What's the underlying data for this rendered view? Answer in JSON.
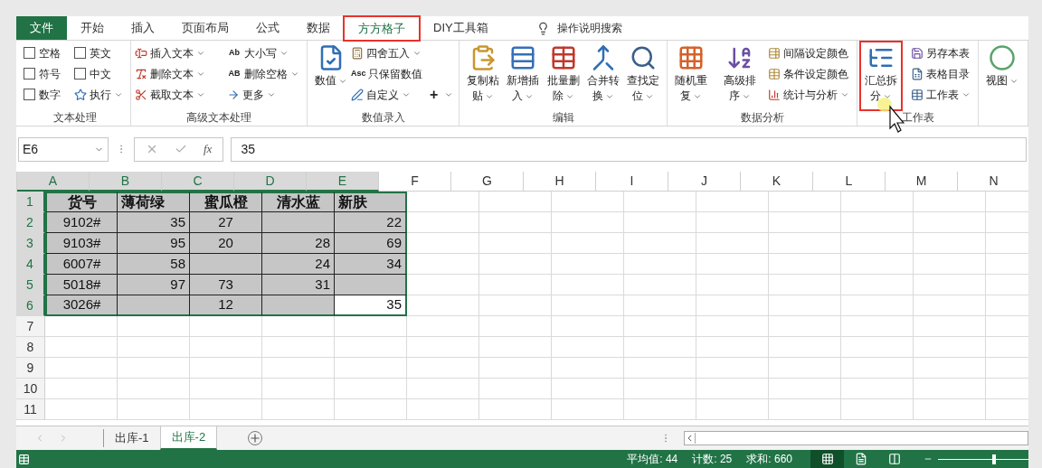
{
  "tabs": [
    {
      "label": "文件",
      "kind": "file",
      "selected": false,
      "highlighted": false
    },
    {
      "label": "开始",
      "kind": "tab",
      "selected": false,
      "highlighted": false
    },
    {
      "label": "插入",
      "kind": "tab",
      "selected": false,
      "highlighted": false
    },
    {
      "label": "页面布局",
      "kind": "tab",
      "selected": false,
      "highlighted": false
    },
    {
      "label": "公式",
      "kind": "tab",
      "selected": false,
      "highlighted": false
    },
    {
      "label": "数据",
      "kind": "tab",
      "selected": false,
      "highlighted": false
    },
    {
      "label": "方方格子",
      "kind": "tab",
      "selected": true,
      "highlighted": true
    },
    {
      "label": "DIY工具箱",
      "kind": "tab",
      "selected": false,
      "highlighted": false
    }
  ],
  "search": {
    "placeholder": "操作说明搜索"
  },
  "ribbon": [
    {
      "label": "文本处理",
      "columns": [
        {
          "kind": "stack",
          "items": [
            {
              "kind": "checkbox",
              "label": "空格",
              "checked": false
            },
            {
              "kind": "checkbox",
              "label": "符号",
              "checked": false
            },
            {
              "kind": "checkbox",
              "label": "数字",
              "checked": false
            }
          ]
        },
        {
          "kind": "stack",
          "items": [
            {
              "kind": "checkbox",
              "label": "英文",
              "checked": false
            },
            {
              "kind": "checkbox",
              "label": "中文",
              "checked": false
            },
            {
              "kind": "small",
              "label": "执行",
              "dropdown": true
            }
          ]
        }
      ]
    },
    {
      "label": "高级文本处理",
      "columns": [
        {
          "kind": "stack",
          "items": [
            {
              "kind": "small",
              "label": "插入文本",
              "dropdown": true
            },
            {
              "kind": "small",
              "label": "删除文本",
              "dropdown": true
            },
            {
              "kind": "small",
              "label": "截取文本",
              "dropdown": true
            }
          ]
        },
        {
          "kind": "stack",
          "items": [
            {
              "kind": "small",
              "label": "大小写",
              "icon_text": "Ab",
              "dropdown": true
            },
            {
              "kind": "small",
              "label": "删除空格",
              "icon_text": "AB",
              "dropdown": true
            },
            {
              "kind": "small",
              "label": "更多",
              "dropdown": true
            }
          ]
        }
      ]
    },
    {
      "label": "数值录入",
      "columns": [
        {
          "kind": "large",
          "label": "数值",
          "dropdown": true,
          "highlighted": false
        },
        {
          "kind": "stack",
          "items": [
            {
              "kind": "small",
              "label": "四舍五入",
              "dropdown": true
            },
            {
              "kind": "small",
              "label": "只保留数值",
              "icon_text": "Asc",
              "dropdown": false
            },
            {
              "kind": "small",
              "label": "自定义",
              "dropdown": true
            }
          ]
        },
        {
          "kind": "stack",
          "items": [
            {
              "kind": "spacer"
            },
            {
              "kind": "spacer"
            },
            {
              "kind": "plain",
              "label": "+",
              "dropdown": true
            }
          ]
        }
      ]
    },
    {
      "label": "编辑",
      "columns": [
        {
          "kind": "large",
          "label": "复制粘贴",
          "dropdown": true,
          "highlighted": false
        },
        {
          "kind": "large",
          "label": "新增插入",
          "dropdown": true,
          "highlighted": false
        },
        {
          "kind": "large",
          "label": "批量删除",
          "dropdown": true,
          "highlighted": false
        },
        {
          "kind": "large",
          "label": "合并转换",
          "dropdown": true,
          "highlighted": false
        },
        {
          "kind": "large",
          "label": "查找定位",
          "dropdown": true,
          "highlighted": false
        }
      ]
    },
    {
      "label": "数据分析",
      "columns": [
        {
          "kind": "large",
          "label": "随机重复",
          "dropdown": true,
          "highlighted": false
        },
        {
          "kind": "large",
          "label": "高级排序",
          "dropdown": true,
          "highlighted": false
        },
        {
          "kind": "stack",
          "items": [
            {
              "kind": "small",
              "label": "间隔设定颜色",
              "dropdown": false
            },
            {
              "kind": "small",
              "label": "条件设定颜色",
              "dropdown": false
            },
            {
              "kind": "small",
              "label": "统计与分析",
              "dropdown": true
            }
          ]
        }
      ]
    },
    {
      "label": "工作表",
      "columns": [
        {
          "kind": "large",
          "label": "汇总拆分",
          "dropdown": true,
          "highlighted": true
        },
        {
          "kind": "stack",
          "items": [
            {
              "kind": "small",
              "label": "另存本表",
              "dropdown": false
            },
            {
              "kind": "small",
              "label": "表格目录",
              "dropdown": false
            },
            {
              "kind": "small",
              "label": "工作表",
              "dropdown": true
            }
          ]
        }
      ]
    },
    {
      "columns": [
        {
          "kind": "large",
          "label": "视图",
          "dropdown": true,
          "highlighted": false
        }
      ]
    }
  ],
  "formula_bar": {
    "name_box": "E6",
    "function_label": "fx",
    "value": "35"
  },
  "columns": [
    {
      "label": "A",
      "selected": true
    },
    {
      "label": "B",
      "selected": true
    },
    {
      "label": "C",
      "selected": true
    },
    {
      "label": "D",
      "selected": true
    },
    {
      "label": "E",
      "selected": true
    },
    {
      "label": "F",
      "selected": false
    },
    {
      "label": "G",
      "selected": false
    },
    {
      "label": "H",
      "selected": false
    },
    {
      "label": "I",
      "selected": false
    },
    {
      "label": "J",
      "selected": false
    },
    {
      "label": "K",
      "selected": false
    },
    {
      "label": "L",
      "selected": false
    },
    {
      "label": "M",
      "selected": false
    },
    {
      "label": "N",
      "selected": false
    }
  ],
  "rows": [
    {
      "number": "1",
      "selected": true,
      "cells": [
        {
          "text": "货号",
          "centered": true,
          "bold": true,
          "active": false
        },
        {
          "text": "薄荷绿",
          "centered": false,
          "bold": true,
          "active": false
        },
        {
          "text": "蜜瓜橙",
          "centered": true,
          "bold": true,
          "active": false
        },
        {
          "text": "清水蓝",
          "centered": true,
          "bold": true,
          "active": false
        },
        {
          "text": "新肤",
          "centered": false,
          "bold": true,
          "active": false
        }
      ]
    },
    {
      "number": "2",
      "selected": true,
      "cells": [
        {
          "text": "9102#",
          "centered": true,
          "bold": false,
          "active": false
        },
        {
          "text": "35",
          "centered": false,
          "bold": false,
          "active": false
        },
        {
          "text": "27",
          "centered": true,
          "bold": false,
          "active": false
        },
        null,
        {
          "text": "22",
          "centered": false,
          "bold": false,
          "active": false
        }
      ]
    },
    {
      "number": "3",
      "selected": true,
      "cells": [
        {
          "text": "9103#",
          "centered": true,
          "bold": false,
          "active": false
        },
        {
          "text": "95",
          "centered": false,
          "bold": false,
          "active": false
        },
        {
          "text": "20",
          "centered": true,
          "bold": false,
          "active": false
        },
        {
          "text": "28",
          "centered": false,
          "bold": false,
          "active": false
        },
        {
          "text": "69",
          "centered": false,
          "bold": false,
          "active": false
        }
      ]
    },
    {
      "number": "4",
      "selected": true,
      "cells": [
        {
          "text": "6007#",
          "centered": true,
          "bold": false,
          "active": false
        },
        {
          "text": "58",
          "centered": false,
          "bold": false,
          "active": false
        },
        null,
        {
          "text": "24",
          "centered": false,
          "bold": false,
          "active": false
        },
        {
          "text": "34",
          "centered": false,
          "bold": false,
          "active": false
        }
      ]
    },
    {
      "number": "5",
      "selected": true,
      "cells": [
        {
          "text": "5018#",
          "centered": true,
          "bold": false,
          "active": false
        },
        {
          "text": "97",
          "centered": false,
          "bold": false,
          "active": false
        },
        {
          "text": "73",
          "centered": true,
          "bold": false,
          "active": false
        },
        {
          "text": "31",
          "centered": false,
          "bold": false,
          "active": false
        },
        null
      ]
    },
    {
      "number": "6",
      "selected": true,
      "cells": [
        {
          "text": "3026#",
          "centered": true,
          "bold": false,
          "active": false
        },
        null,
        {
          "text": "12",
          "centered": true,
          "bold": false,
          "active": false
        },
        null,
        {
          "text": "35",
          "centered": false,
          "bold": false,
          "active": true
        }
      ]
    },
    {
      "number": "7",
      "selected": false,
      "cells": []
    },
    {
      "number": "8",
      "selected": false,
      "cells": []
    },
    {
      "number": "9",
      "selected": false,
      "cells": []
    },
    {
      "number": "10",
      "selected": false,
      "cells": []
    },
    {
      "number": "11",
      "selected": false,
      "cells": []
    }
  ],
  "sheets": [
    {
      "label": "出库-1",
      "selected": false
    },
    {
      "label": "出库-2",
      "selected": true
    }
  ],
  "status_bar": {
    "stats": [
      "平均值: 44",
      "计数: 25",
      "求和: 660"
    ],
    "views": [
      {
        "kind": "normal",
        "selected": true
      },
      {
        "kind": "page_layout",
        "selected": false
      },
      {
        "kind": "page_break",
        "selected": false
      }
    ],
    "zoom": {
      "level": 0.62
    }
  }
}
